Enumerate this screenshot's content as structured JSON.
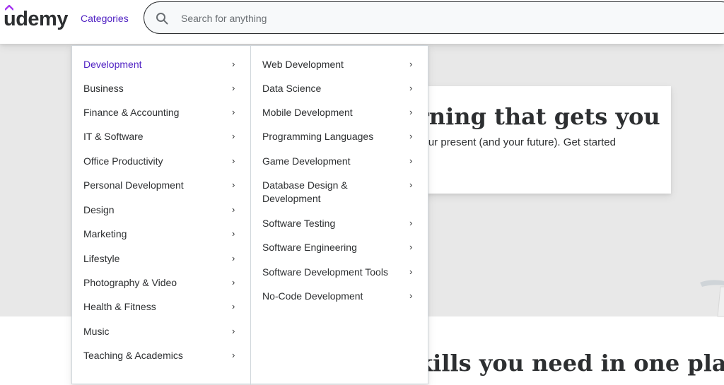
{
  "header": {
    "logo_text": "udemy",
    "categories_label": "Categories",
    "search_placeholder": "Search for anything"
  },
  "hero": {
    "title": "rning that gets you",
    "subtitle": "your present (and your future). Get started"
  },
  "section": {
    "title": "kills you need in one place"
  },
  "menu": {
    "categories": [
      {
        "label": "Development",
        "active": true
      },
      {
        "label": "Business"
      },
      {
        "label": "Finance & Accounting"
      },
      {
        "label": "IT & Software"
      },
      {
        "label": "Office Productivity"
      },
      {
        "label": "Personal Development"
      },
      {
        "label": "Design"
      },
      {
        "label": "Marketing"
      },
      {
        "label": "Lifestyle"
      },
      {
        "label": "Photography & Video"
      },
      {
        "label": "Health & Fitness"
      },
      {
        "label": "Music"
      },
      {
        "label": "Teaching & Academics"
      }
    ],
    "subcategories": [
      {
        "label": "Web Development"
      },
      {
        "label": "Data Science"
      },
      {
        "label": "Mobile Development"
      },
      {
        "label": "Programming Languages"
      },
      {
        "label": "Game Development"
      },
      {
        "label": "Database Design & Development"
      },
      {
        "label": "Software Testing"
      },
      {
        "label": "Software Engineering"
      },
      {
        "label": "Software Development Tools"
      },
      {
        "label": "No-Code Development"
      }
    ],
    "chevron": "›"
  },
  "colors": {
    "accent": "#5022c3",
    "text": "#2d2f31",
    "hero_bg": "#e8e8e8",
    "border": "#d1d7dc"
  },
  "icons": {
    "logo_hat": "logo-hat-icon",
    "search": "search-icon",
    "chevron": "chevron-right-icon"
  }
}
